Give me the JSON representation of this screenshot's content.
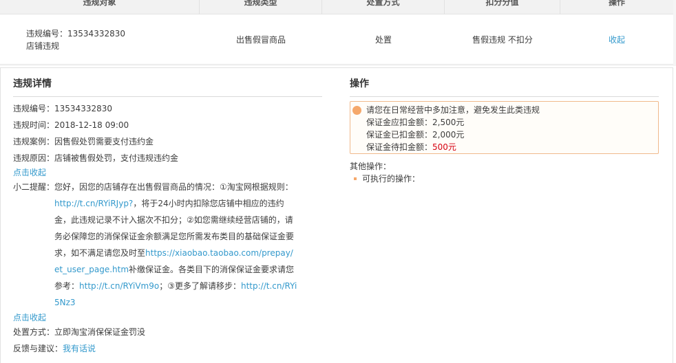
{
  "table": {
    "headers": [
      "违规对象",
      "违规类型",
      "处置方式",
      "扣分分值",
      "操作"
    ],
    "row": {
      "id_label": "违规编号：",
      "id_value": "13534332830",
      "object": "店铺违规",
      "type": "出售假冒商品",
      "handling": "处置",
      "points": "售假违规 不扣分",
      "action": "收起"
    }
  },
  "details": {
    "title": "违规详情",
    "id_label": "违规编号：",
    "id_value": "13534332830",
    "time_label": "违规时间：",
    "time_value": "2018-12-18 09:00",
    "case_label": "违规案例：",
    "case_value": "因售假处罚需要支付违约金",
    "reason_label": "违规原因：",
    "reason_value": "店铺被售假处罚，支付违规违约金",
    "collapse_label": "点击收起",
    "notice_label": "小二提醒：",
    "notice_intro": "您好，因您的店铺存在出售假冒商品的情况：①淘宝网根据规则：",
    "notice_link1": "http://t.cn/RYiRJyp?",
    "notice_part2": "，将于24小时内扣除您店铺中相应的违约金，此违规记录不计入据次不扣分；②如您需继续经营店铺的，请务必保障您的消保保证金余额满足您所需发布类目的基础保证金要求，如不满足请您及时至",
    "notice_link2": "https://xiaobao.taobao.com/prepay/et_user_page.htm",
    "notice_part3": "补缴保证金。各类目下的消保保证金要求请您参考：",
    "notice_link3": "http://t.cn/RYiVm9o",
    "notice_part4": "；③更多了解请移步：",
    "notice_link4": "http://t.cn/RYi5Nz3",
    "collapse_label2": "点击收起",
    "method_label": "处置方式：",
    "method_value": "立即淘宝消保保证金罚没",
    "feedback_label": "反馈与建议：",
    "feedback_link": "我有话说"
  },
  "operation": {
    "title": "操作",
    "warn_text": "请您在日常经营中多加注意，避免发生此类违规",
    "due_label": "保证金应扣金额：",
    "due_value": "2,500元",
    "paid_label": "保证金已扣金额：",
    "paid_value": "2,000元",
    "pending_label": "保证金待扣金额：",
    "pending_value": "500元",
    "other_label": "其他操作：",
    "exec_label": "可执行的操作："
  },
  "colors": {
    "link": "#3399cc",
    "warn_border": "#f0b98b",
    "warn_icon": "#f5a86b",
    "emphasis_red": "#d6000f"
  }
}
